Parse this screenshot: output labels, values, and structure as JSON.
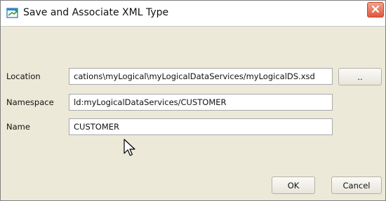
{
  "dialog": {
    "title": "Save and Associate XML Type",
    "title_icon": "xml-type-icon",
    "close_icon": "close-icon"
  },
  "form": {
    "location": {
      "label": "Location",
      "value": "cations\\myLogical\\myLogicalDataServices/myLogicalDS.xsd",
      "browse_label": ".."
    },
    "namespace": {
      "label": "Namespace",
      "value": "ld:myLogicalDataServices/CUSTOMER"
    },
    "name": {
      "label": "Name",
      "value": "CUSTOMER"
    }
  },
  "buttons": {
    "ok": "OK",
    "cancel": "Cancel"
  },
  "colors": {
    "close_button": "#e0583b",
    "dialog_background": "#ece9d8"
  }
}
